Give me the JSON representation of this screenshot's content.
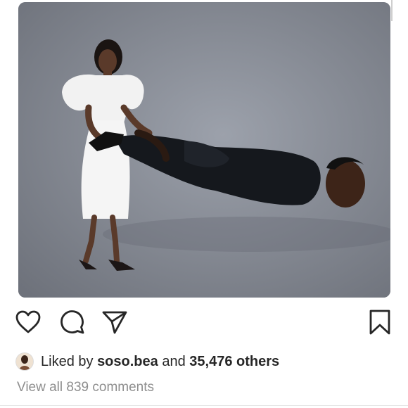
{
  "post": {
    "liker_prefix": "Liked by",
    "liker_username": "soso.bea",
    "likes_joiner": "and",
    "likes_rest": "35,476 others",
    "view_comments": "View all 839 comments"
  },
  "icons": [
    "heart-icon",
    "comment-icon",
    "share-icon",
    "bookmark-icon"
  ],
  "colors": {
    "text": "#262626",
    "muted": "#8e8e8e",
    "background": "#ffffff"
  }
}
